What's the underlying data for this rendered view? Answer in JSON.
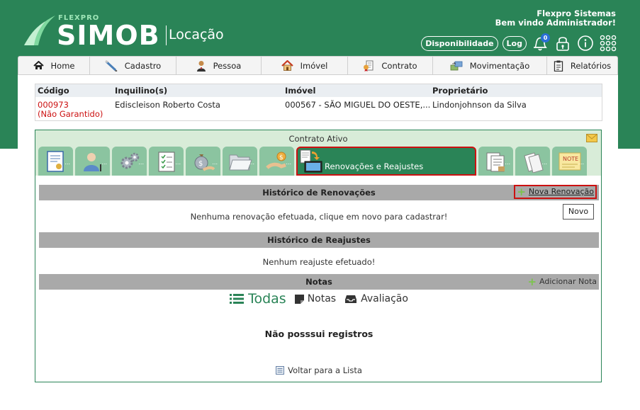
{
  "app": {
    "brand_small": "FLEXPRO",
    "brand": "SIMOB",
    "module": "Locação"
  },
  "user": {
    "company": "Flexpro Sistemas",
    "welcome": "Bem vindo Administrador!"
  },
  "header_actions": {
    "disponibilidade": "Disponibilidade",
    "log": "Log",
    "notification_count": "0"
  },
  "nav": {
    "items": [
      {
        "label": "Home",
        "icon": "home-icon"
      },
      {
        "label": "Cadastro",
        "icon": "pencil-icon"
      },
      {
        "label": "Pessoa",
        "icon": "person-icon"
      },
      {
        "label": "Imóvel",
        "icon": "house-icon"
      },
      {
        "label": "Contrato",
        "icon": "contract-icon"
      },
      {
        "label": "Movimentação",
        "icon": "transfer-icon"
      },
      {
        "label": "Relatórios",
        "icon": "clipboard-icon"
      }
    ]
  },
  "contract_info": {
    "headers": [
      "Código",
      "Inquilino(s)",
      "Imóvel",
      "Proprietário"
    ],
    "code": "000973",
    "code_status": "(Não Garantido)",
    "tenant": "Ediscleison Roberto Costa",
    "property": "000567 - SÃO MIGUEL DO OESTE,...",
    "owner": "Lindonjohnson da Silva"
  },
  "contract_panel": {
    "title": "Contrato Ativo",
    "tab_placeholder": "...",
    "active_tab": "Renovações e Reajustes"
  },
  "renovacoes": {
    "title": "Histórico de Renovações",
    "new_label": "Nova Renovação",
    "empty": "Nenhuma renovação efetuada, clique em novo para cadastrar!",
    "tooltip": "Novo"
  },
  "reajustes": {
    "title": "Histórico de Reajustes",
    "empty": "Nenhum reajuste efetuado!"
  },
  "notas": {
    "title": "Notas",
    "add_label": "Adicionar Nota",
    "filters": {
      "todas": "Todas",
      "notas": "Notas",
      "avaliacao": "Avaliação"
    },
    "empty": "Não posssui registros"
  },
  "footer": {
    "back": "Voltar para a Lista"
  },
  "colors": {
    "brand_green": "#2a8457",
    "light_green": "#8bc4a0",
    "highlight_red": "#cc1111"
  }
}
